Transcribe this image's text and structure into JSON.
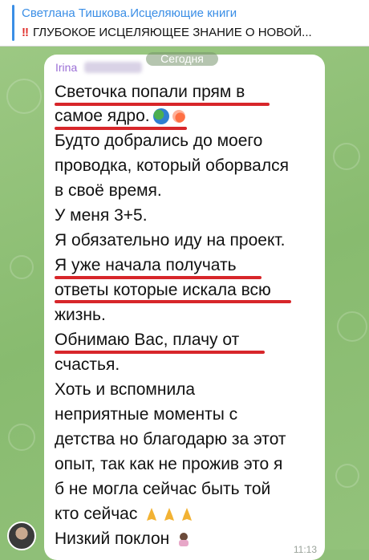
{
  "pinned": {
    "title": "Светлана Тишкова.Исцеляющие книги",
    "marker": "!!",
    "message": "ГЛУБОКОЕ ИСЦЕЛЯЮЩЕЕ ЗНАНИЕ О НОВОЙ..."
  },
  "date_chip": "Сегодня",
  "message": {
    "sender": "Irina",
    "lines": [
      "Светочка попали прям в",
      "самое ядро.",
      "Будто добрались до моего",
      "проводка, который оборвался",
      "в своё время.",
      "У меня 3+5.",
      "Я обязательно иду на проект.",
      "Я уже начала получать",
      "ответы которые искала всю",
      "жизнь.",
      "Обнимаю Вас, плачу от",
      "счастья.",
      "Хоть и вспомнила",
      "неприятные моменты с",
      "детства но благодарю за этот",
      "опыт, так как не прожив это я",
      "б не могла сейчас быть той",
      "кто сейчас",
      "Низкий поклон"
    ],
    "time": "11:13"
  },
  "colors": {
    "accent": "#3a8ee6",
    "sender": "#9b6fd6",
    "highlight": "#d7262a",
    "wallpaper": "#8fbf78"
  },
  "icons": [
    "globe-emoji",
    "comet-emoji",
    "praying-hands-emoji",
    "bowing-person-emoji",
    "avatar"
  ]
}
